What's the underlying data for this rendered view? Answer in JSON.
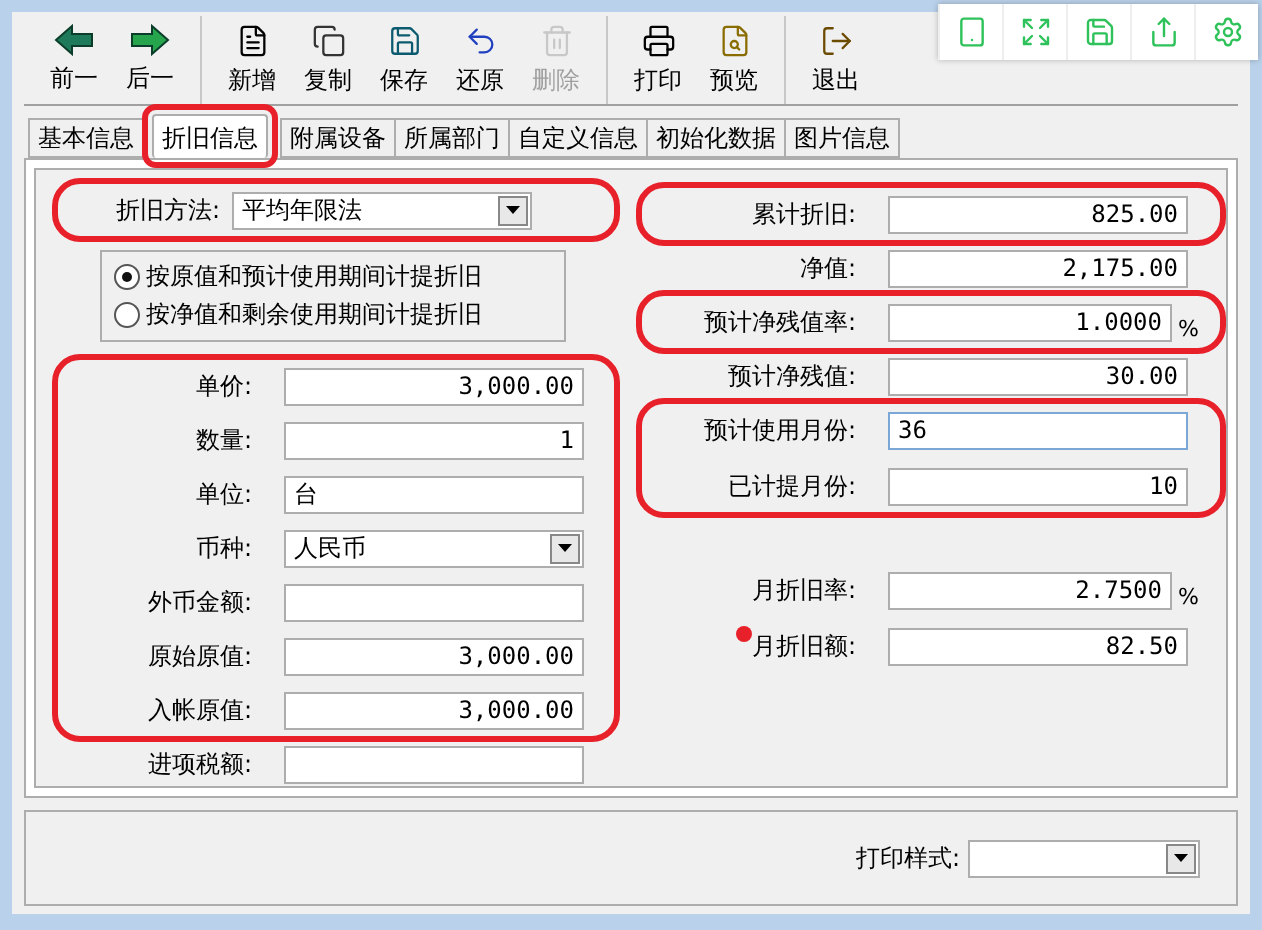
{
  "overlay_tools": [
    {
      "kind": "tablet"
    },
    {
      "kind": "expand"
    },
    {
      "kind": "save"
    },
    {
      "kind": "share"
    },
    {
      "kind": "settings"
    }
  ],
  "toolbar": [
    [
      {
        "label": "前一",
        "kind": "back",
        "disabled": false
      },
      {
        "label": "后一",
        "kind": "forward",
        "disabled": false
      }
    ],
    [
      {
        "label": "新增",
        "kind": "new",
        "disabled": false
      },
      {
        "label": "复制",
        "kind": "copy",
        "disabled": false
      },
      {
        "label": "保存",
        "kind": "save",
        "disabled": false
      },
      {
        "label": "还原",
        "kind": "undo",
        "disabled": false
      },
      {
        "label": "删除",
        "kind": "delete",
        "disabled": true
      }
    ],
    [
      {
        "label": "打印",
        "kind": "print",
        "disabled": false
      },
      {
        "label": "预览",
        "kind": "preview",
        "disabled": false
      }
    ],
    [
      {
        "label": "退出",
        "kind": "exit",
        "disabled": false
      }
    ]
  ],
  "tabs": [
    {
      "label": "基本信息",
      "selected": false,
      "highlighted": false
    },
    {
      "label": "折旧信息",
      "selected": true,
      "highlighted": true
    },
    {
      "label": "附属设备",
      "selected": false,
      "highlighted": false
    },
    {
      "label": "所属部门",
      "selected": false,
      "highlighted": false
    },
    {
      "label": "自定义信息",
      "selected": false,
      "highlighted": false
    },
    {
      "label": "初始化数据",
      "selected": false,
      "highlighted": false
    },
    {
      "label": "图片信息",
      "selected": false,
      "highlighted": false
    }
  ],
  "method": {
    "label": "折旧方法:",
    "value": "平均年限法",
    "highlighted": true
  },
  "method_options": [
    {
      "label": "按原值和预计使用期间计提折旧",
      "selected": true
    },
    {
      "label": "按净值和剩余使用期间计提折旧",
      "selected": false
    }
  ],
  "left_groups": [
    {
      "highlighted": true,
      "fields": [
        {
          "label": "单价:",
          "kind": "number",
          "value": "3,000.00"
        },
        {
          "label": "数量:",
          "kind": "number",
          "value": "1"
        },
        {
          "label": "单位:",
          "kind": "text",
          "value": "台"
        },
        {
          "label": "币种:",
          "kind": "select",
          "value": "人民币"
        },
        {
          "label": "外币金额:",
          "kind": "number"
        },
        {
          "label": "原始原值:",
          "kind": "number",
          "value": "3,000.00"
        },
        {
          "label": "入帐原值:",
          "kind": "number",
          "value": "3,000.00"
        }
      ]
    },
    {
      "highlighted": false,
      "fields": [
        {
          "label": "进项税额:",
          "kind": "number"
        }
      ]
    }
  ],
  "right_groups": [
    {
      "highlighted": true,
      "fields": [
        {
          "label": "累计折旧:",
          "kind": "number",
          "value": "825.00"
        }
      ]
    },
    {
      "highlighted": false,
      "fields": [
        {
          "label": "净值:",
          "kind": "number",
          "value": "2,175.00"
        }
      ]
    },
    {
      "highlighted": true,
      "fields": [
        {
          "label": "预计净残值率:",
          "kind": "number",
          "value": "1.0000",
          "suffix": "%"
        }
      ]
    },
    {
      "highlighted": false,
      "fields": [
        {
          "label": "预计净残值:",
          "kind": "number",
          "value": "30.00"
        }
      ]
    },
    {
      "highlighted": true,
      "fields": [
        {
          "label": "预计使用月份:",
          "kind": "text",
          "value": "36",
          "focused": true
        },
        {
          "label": "已计提月份:",
          "kind": "number",
          "value": "10"
        }
      ]
    },
    {
      "highlighted": false,
      "fields": [
        {
          "label": "月折旧率:",
          "kind": "number",
          "value": "2.7500",
          "suffix": "%"
        },
        {
          "label": "月折旧额:",
          "kind": "number",
          "value": "82.50",
          "marked": true
        }
      ]
    }
  ],
  "print_style": {
    "label": "打印样式:"
  }
}
